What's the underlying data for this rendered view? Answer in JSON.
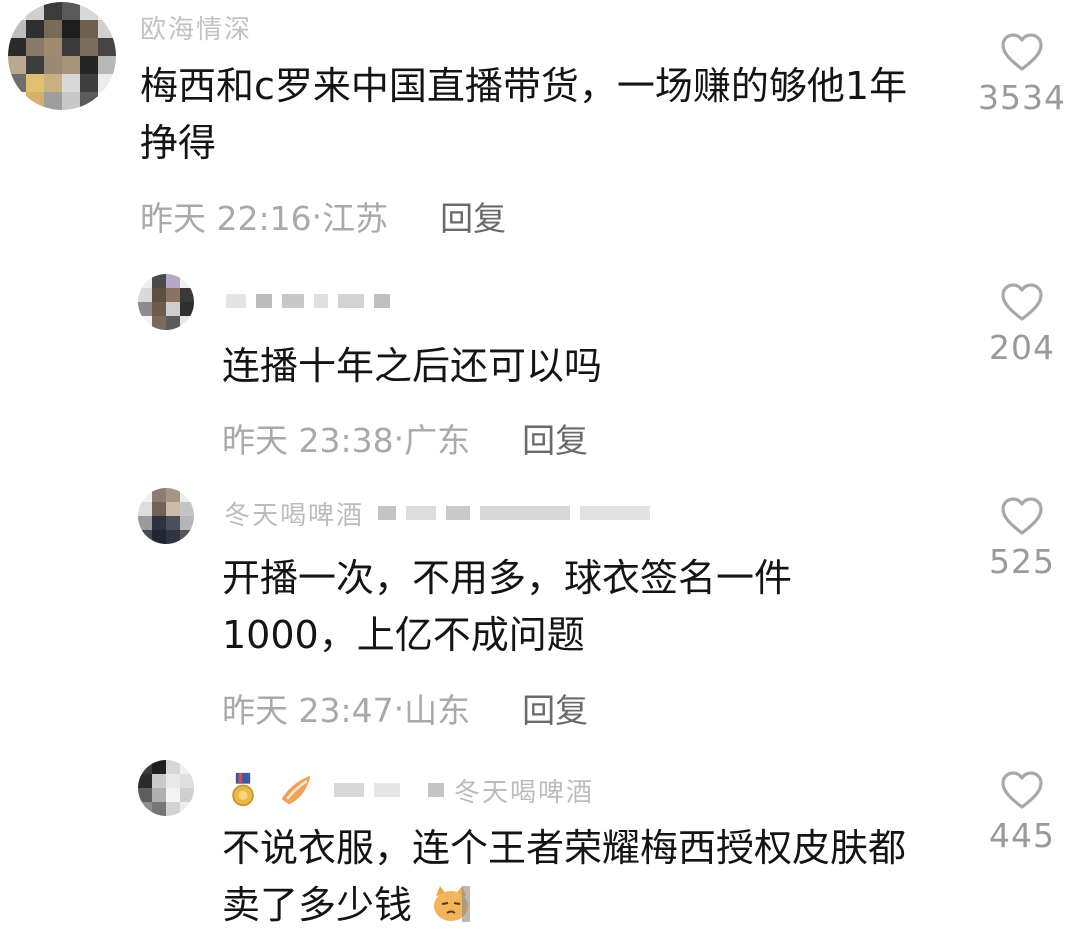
{
  "comments": [
    {
      "username": "欧海情深",
      "text": "梅西和c罗来中国直播带货，一场赚的够他1年挣得",
      "time": "昨天 22:16",
      "location": "江苏",
      "reply_label": "回复",
      "likes": "3534"
    },
    {
      "username": "",
      "text": "连播十年之后还可以吗",
      "time": "昨天 23:38",
      "location": "广东",
      "reply_label": "回复",
      "likes": "204"
    },
    {
      "username": "冬天喝啤酒",
      "text": "开播一次，不用多，球衣签名一件1000，上亿不成问题",
      "time": "昨天 23:47",
      "location": "山东",
      "reply_label": "回复",
      "likes": "525"
    },
    {
      "username": "冬天喝啤酒",
      "text": "不说衣服，连个王者荣耀梅西授权皮肤都卖了多少钱",
      "time": "",
      "location": "",
      "reply_label": "",
      "likes": "445"
    }
  ],
  "icons": {
    "like": "heart-outline-icon",
    "badge_1": "medal-icon",
    "badge_2": "rank-badge-icon",
    "emoji": "cat-emoji-icon"
  },
  "colors": {
    "text": "#141414",
    "meta": "#a9a9a9",
    "reply": "#6a6a6a",
    "like_count": "#9a9a9a"
  }
}
